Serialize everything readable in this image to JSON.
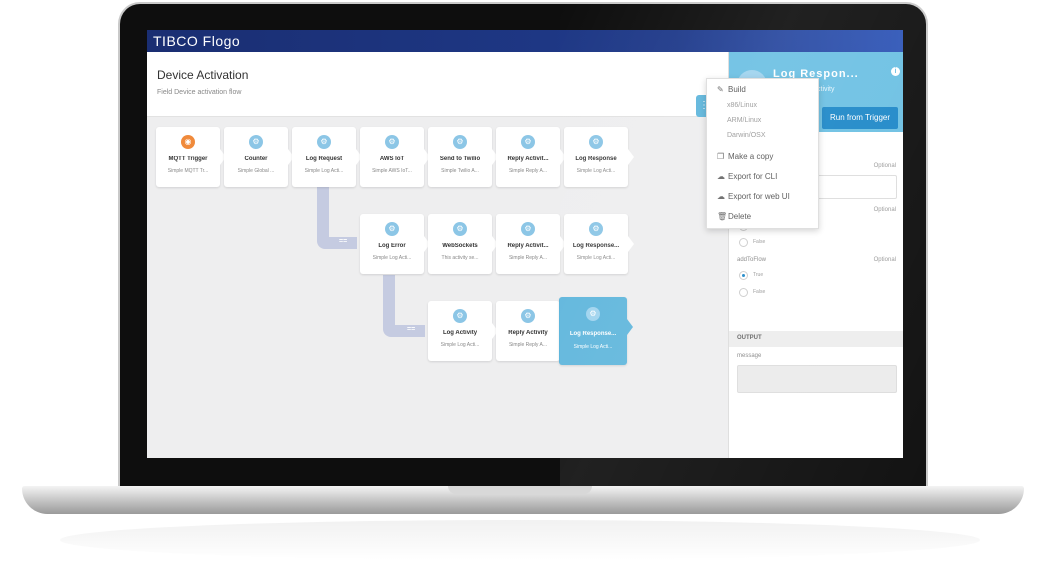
{
  "app": {
    "brand": "TIBCO Flogo"
  },
  "flow": {
    "title": "Device Activation",
    "description": "Field Device activation flow"
  },
  "tiles_row1": [
    {
      "name": "MQTT Trigger",
      "sub": "Simple MQTT Tr..."
    },
    {
      "name": "Counter",
      "sub": "Simple Global ..."
    },
    {
      "name": "Log Request",
      "sub": "Simple Log Acti..."
    },
    {
      "name": "AWS IoT",
      "sub": "Simple AWS IoT..."
    },
    {
      "name": "Send to Twilio",
      "sub": "Simple Twilio A..."
    },
    {
      "name": "Reply Activit...",
      "sub": "Simple Reply A..."
    },
    {
      "name": "Log Response",
      "sub": "Simple Log Acti..."
    }
  ],
  "tiles_row2": [
    {
      "name": "Log Error",
      "sub": "Simple Log Acti..."
    },
    {
      "name": "WebSockets",
      "sub": "This activity se..."
    },
    {
      "name": "Reply Activit...",
      "sub": "Simple Reply A..."
    },
    {
      "name": "Log Response...",
      "sub": "Simple Log Acti..."
    }
  ],
  "tiles_row3": [
    {
      "name": "Log Activity",
      "sub": "Simple Log Acti..."
    },
    {
      "name": "Reply Activity",
      "sub": "Simple Reply A..."
    },
    {
      "name": "Log Response...",
      "sub": "Simple Log Acti..."
    }
  ],
  "branch_mark": "==",
  "menu": {
    "build": "Build",
    "targets": [
      "x86/Linux",
      "ARM/Linux",
      "Darwin/OSX"
    ],
    "copy": "Make a copy",
    "export_cli": "Export for CLI",
    "export_web": "Export for web UI",
    "delete": "Delete"
  },
  "panel": {
    "title": "Log Respon...",
    "subtitle": "ctivity",
    "run_button": "Run from Trigger",
    "optional": "Optional",
    "false_label": "False",
    "true_label": "True",
    "field_addtoflow": "addToFlow",
    "output_header": "OUTPUT",
    "output_field": "message"
  },
  "colors": {
    "accent": "#5fb6dc",
    "topbar": "#1f3a8a",
    "trigger": "#f08a3b",
    "button": "#1e88c8"
  }
}
